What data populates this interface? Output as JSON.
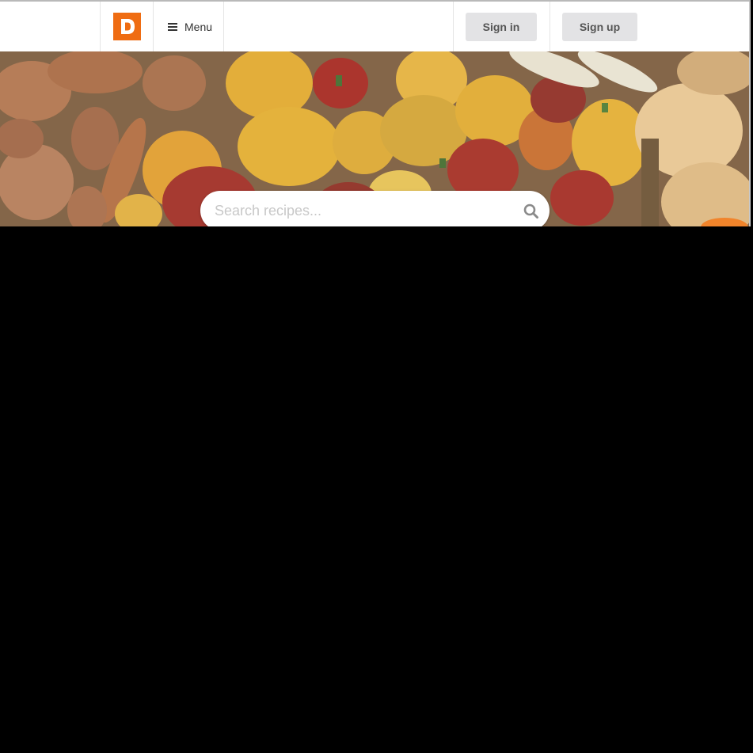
{
  "header": {
    "logo_letter": "D",
    "menu_label": "Menu",
    "signin_label": "Sign in",
    "signup_label": "Sign up"
  },
  "search": {
    "placeholder": "Search recipes..."
  },
  "colors": {
    "brand": "#ef6c12",
    "button_bg": "#e3e3e5",
    "button_text": "#555555"
  },
  "icons": {
    "logo": "logo-icon",
    "menu": "hamburger-icon",
    "search": "search-icon"
  }
}
